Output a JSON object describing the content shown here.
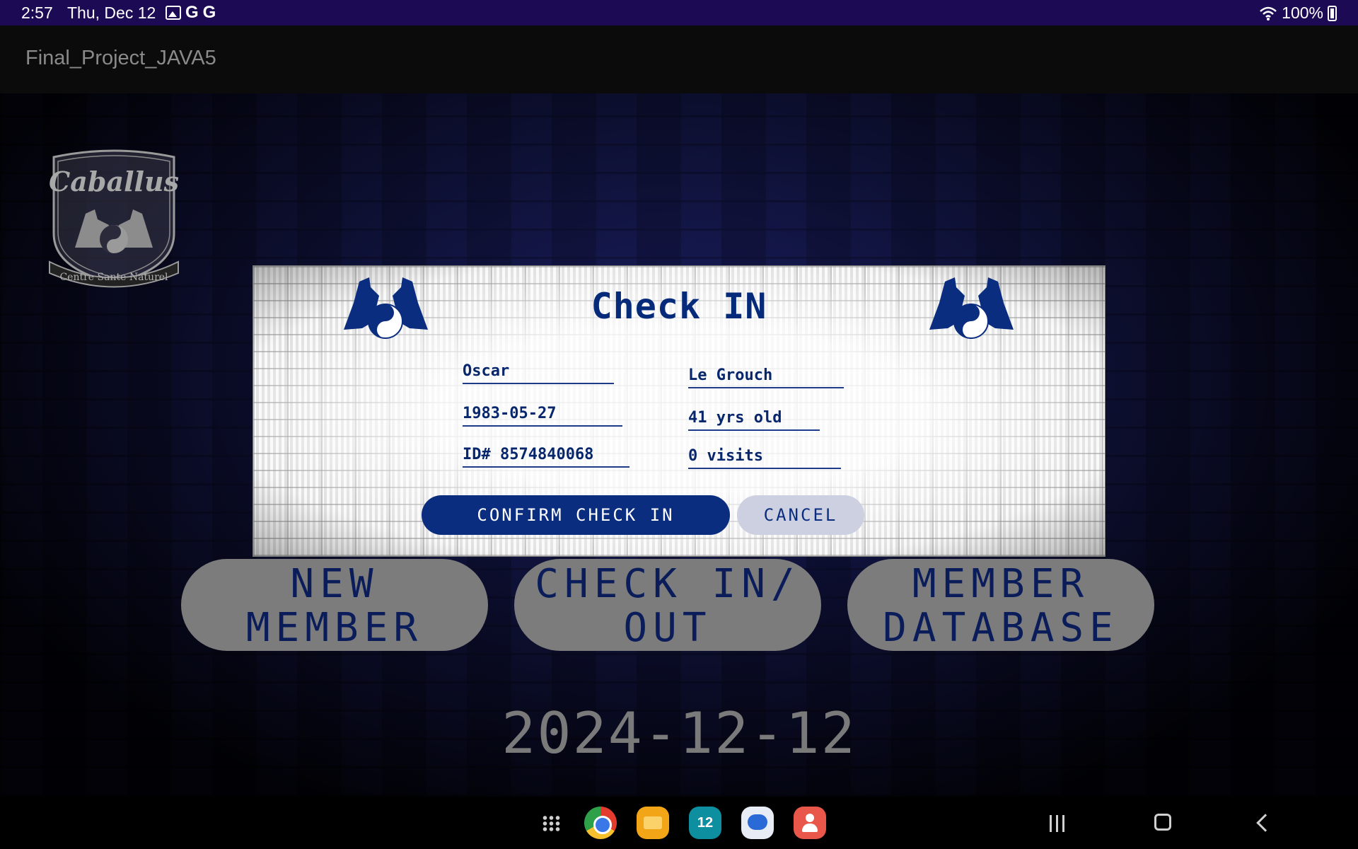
{
  "status_bar": {
    "time": "2:57",
    "date": "Thu, Dec 12",
    "notification_icons": [
      "image-icon",
      "google-icon",
      "google-icon"
    ],
    "g1": "G",
    "g2": "G",
    "battery": "100%"
  },
  "app_bar": {
    "title": "Final_Project_JAVA5"
  },
  "logo": {
    "name": "Caballus",
    "tagline": "Centre Sante Naturel"
  },
  "dialog": {
    "title": "Check IN",
    "first_name": "Oscar",
    "last_name": "Le Grouch",
    "dob": "1983-05-27",
    "age": "41 yrs old",
    "id": "ID# 8574840068",
    "visits": "0 visits",
    "confirm_label": "CONFIRM CHECK IN",
    "cancel_label": "CANCEL"
  },
  "main_buttons": {
    "new_member": "NEW\nMEMBER",
    "check_in_out": "CHECK IN/\nOUT",
    "member_database": "MEMBER\nDATABASE"
  },
  "current_date": "2024-12-12",
  "nav_bar": {
    "calendar_day": "12",
    "apps": [
      "chrome-icon",
      "files-icon",
      "calendar-icon",
      "messages-icon",
      "contacts-icon"
    ]
  },
  "colors": {
    "accent": "#0a2d80",
    "status_bar": "#1c0a55",
    "button_gray": "#7c7c7c"
  }
}
